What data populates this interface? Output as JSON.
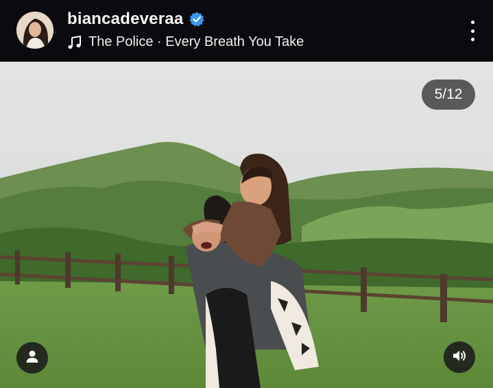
{
  "post": {
    "username": "biancadeveraa",
    "verified": true,
    "music": {
      "icon": "music-note-icon",
      "label": "The Police · Every Breath You Take"
    },
    "menu_icon": "more-vertical-icon"
  },
  "carousel": {
    "counter": "5/12"
  },
  "controls": {
    "tagged_users_icon": "user-icon",
    "audio_icon": "speaker-icon"
  },
  "colors": {
    "header_bg": "#0b0b0f",
    "verified_blue": "#3897f0",
    "text": "#f5f5f5"
  }
}
